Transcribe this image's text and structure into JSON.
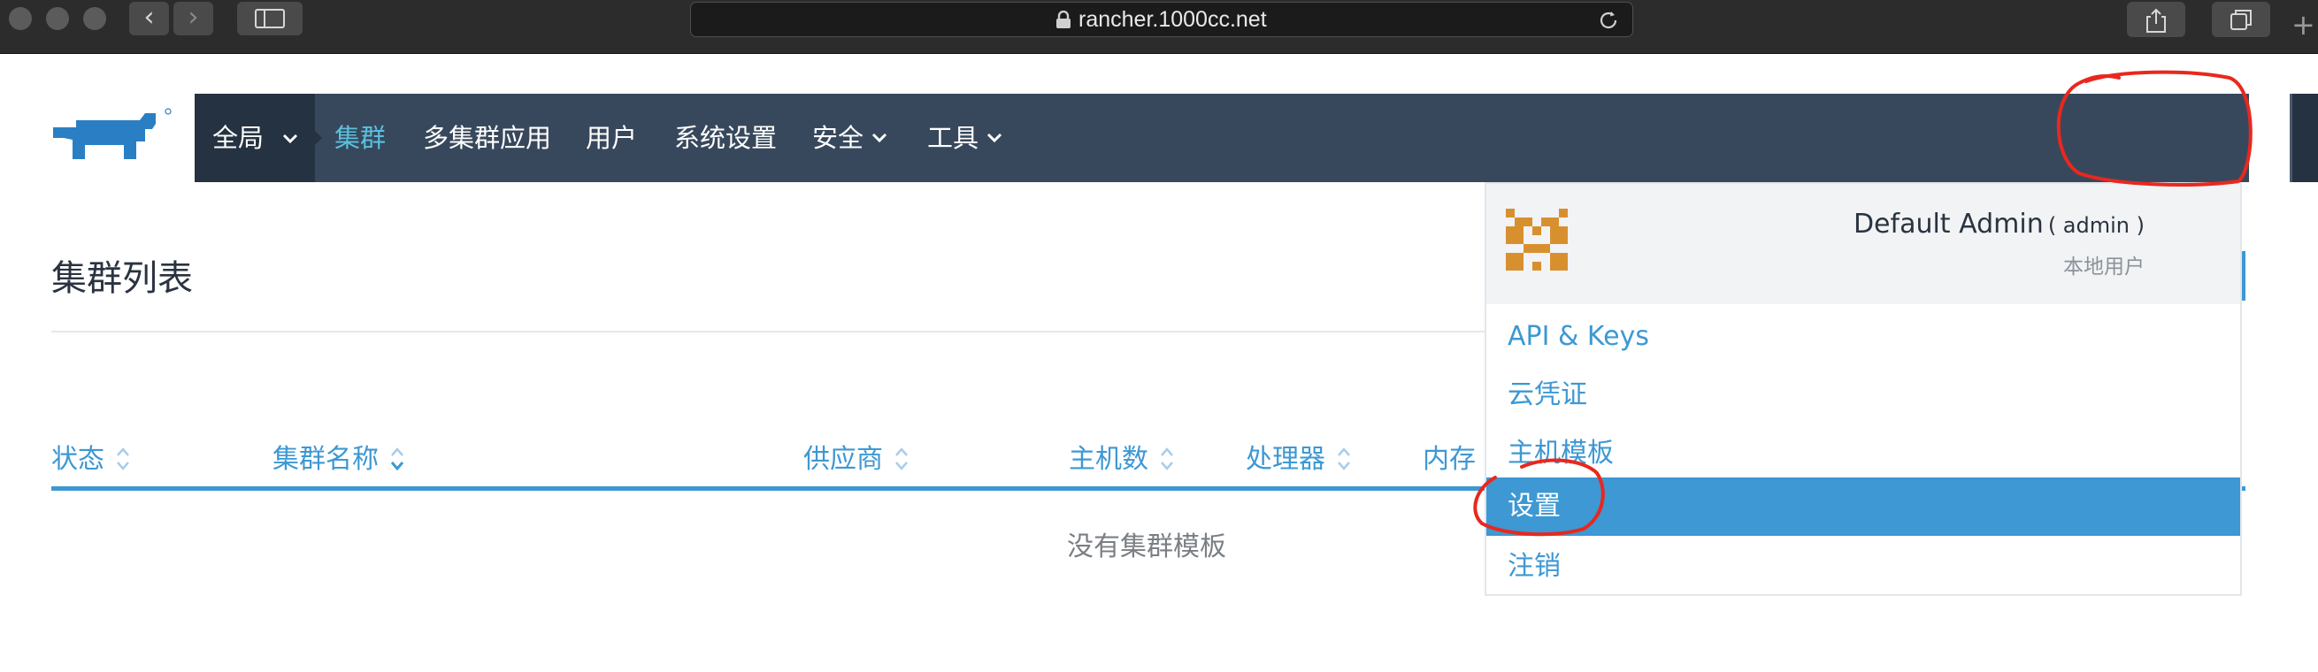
{
  "browser": {
    "url": "rancher.1000cc.net",
    "back_glyph": "‹",
    "forward_glyph": "›",
    "icons": [
      "sidebar-toggle-icon",
      "lock-icon",
      "reload-icon",
      "share-icon",
      "tabs-overview-icon",
      "new-tab-icon"
    ]
  },
  "nav": {
    "global_label": "全局",
    "items": [
      {
        "label": "集群",
        "active": true
      },
      {
        "label": "多集群应用"
      },
      {
        "label": "用户"
      },
      {
        "label": "系统设置"
      },
      {
        "label": "安全",
        "has_caret": true
      },
      {
        "label": "工具",
        "has_caret": true
      }
    ]
  },
  "page": {
    "title": "集群列表",
    "columns": [
      "状态",
      "集群名称",
      "供应商",
      "主机数",
      "处理器",
      "内存"
    ],
    "empty_message": "没有集群模板"
  },
  "user_menu": {
    "display_name": "Default Admin",
    "login": "( admin )",
    "user_type": "本地用户",
    "items": [
      {
        "label": "API & Keys"
      },
      {
        "label": "云凭证"
      },
      {
        "label": "主机模板"
      },
      {
        "label": "设置",
        "selected": true
      },
      {
        "label": "注销"
      }
    ]
  },
  "colors": {
    "nav_bg": "#38485c",
    "nav_dark": "#253241",
    "accent_blue": "#3d98d3",
    "active_nav": "#5bc0de",
    "avatar_orange": "#d8902f",
    "annotation_red": "#e8281e"
  }
}
